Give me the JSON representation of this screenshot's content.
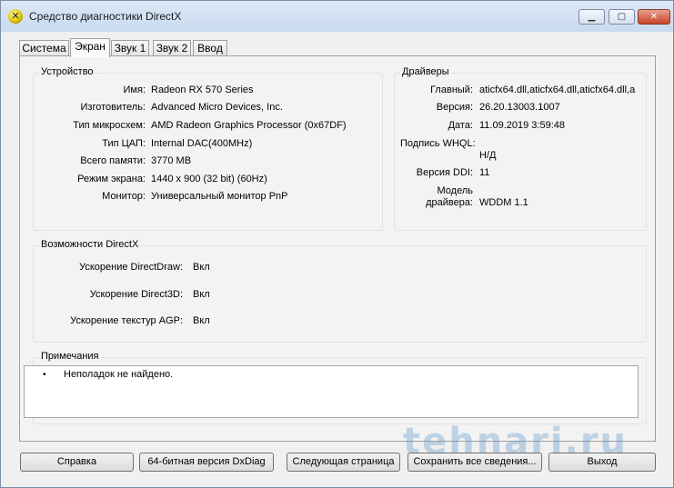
{
  "window": {
    "title": "Средство диагностики DirectX",
    "icon": "directx-icon",
    "icon_glyph": "✕",
    "controls": {
      "minimize": "minimize-icon",
      "maximize": "maximize-icon",
      "close": "close-icon"
    }
  },
  "tabs": [
    {
      "label": "Система",
      "active": false
    },
    {
      "label": "Экран",
      "active": true
    },
    {
      "label": "Звук 1",
      "active": false
    },
    {
      "label": "Звук 2",
      "active": false
    },
    {
      "label": "Ввод",
      "active": false
    }
  ],
  "device": {
    "title": "Устройство",
    "rows": [
      {
        "label": "Имя:",
        "value": "Radeon RX 570 Series"
      },
      {
        "label": "Изготовитель:",
        "value": "Advanced Micro Devices, Inc."
      },
      {
        "label": "Тип микросхем:",
        "value": "AMD Radeon Graphics Processor (0x67DF)"
      },
      {
        "label": "Тип ЦАП:",
        "value": "Internal DAC(400MHz)"
      },
      {
        "label": "Всего памяти:",
        "value": "3770 MB"
      },
      {
        "label": "Режим экрана:",
        "value": "1440 x 900 (32 bit) (60Hz)"
      },
      {
        "label": "Монитор:",
        "value": "Универсальный монитор PnP"
      }
    ]
  },
  "drivers": {
    "title": "Драйверы",
    "main_label": "Главный:",
    "main_value": "aticfx64.dll,aticfx64.dll,aticfx64.dll,a",
    "version_label": "Версия:",
    "version_value": "26.20.13003.1007",
    "date_label": "Дата:",
    "date_value": "11.09.2019 3:59:48",
    "whql_label": "Подпись WHQL:",
    "whql_value": "Н/Д",
    "ddi_label": "Версия DDI:",
    "ddi_value": "11",
    "model_label_1": "Модель",
    "model_label_2": "драйвера:",
    "model_value": "WDDM 1.1"
  },
  "directx": {
    "title": "Возможности DirectX",
    "rows": [
      {
        "label": "Ускорение DirectDraw:",
        "value": "Вкл"
      },
      {
        "label": "Ускорение Direct3D:",
        "value": "Вкл"
      },
      {
        "label": "Ускорение текстур AGP:",
        "value": "Вкл"
      }
    ]
  },
  "notes": {
    "title": "Примечания",
    "bullet": "•",
    "items": [
      "Неполадок не найдено."
    ]
  },
  "buttons": {
    "help": "Справка",
    "dxdiag64": "64-битная версия DxDiag",
    "next_page": "Следующая страница",
    "save_all": "Сохранить все сведения...",
    "exit": "Выход"
  },
  "watermark": "tehnari.ru"
}
